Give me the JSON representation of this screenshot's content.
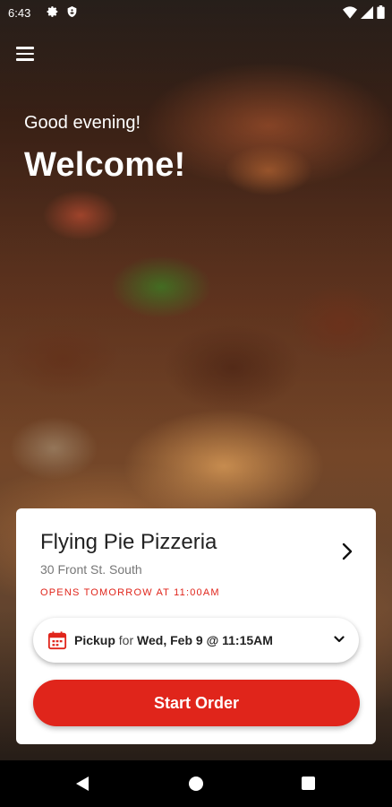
{
  "status_bar": {
    "time": "6:43",
    "left_icons": [
      "gear-icon",
      "shield-icon"
    ],
    "right_icons": [
      "wifi-icon",
      "signal-icon",
      "battery-icon"
    ]
  },
  "hero": {
    "greeting": "Good evening!",
    "welcome": "Welcome!"
  },
  "store": {
    "name": "Flying Pie Pizzeria",
    "address": "30 Front St. South",
    "hours": "OPENS TOMORROW AT 11:00AM"
  },
  "pickup": {
    "mode": "Pickup",
    "connector": " for ",
    "datetime": "Wed, Feb 9 @ 11:15AM"
  },
  "actions": {
    "start_order": "Start Order"
  },
  "colors": {
    "accent": "#e0251b"
  }
}
